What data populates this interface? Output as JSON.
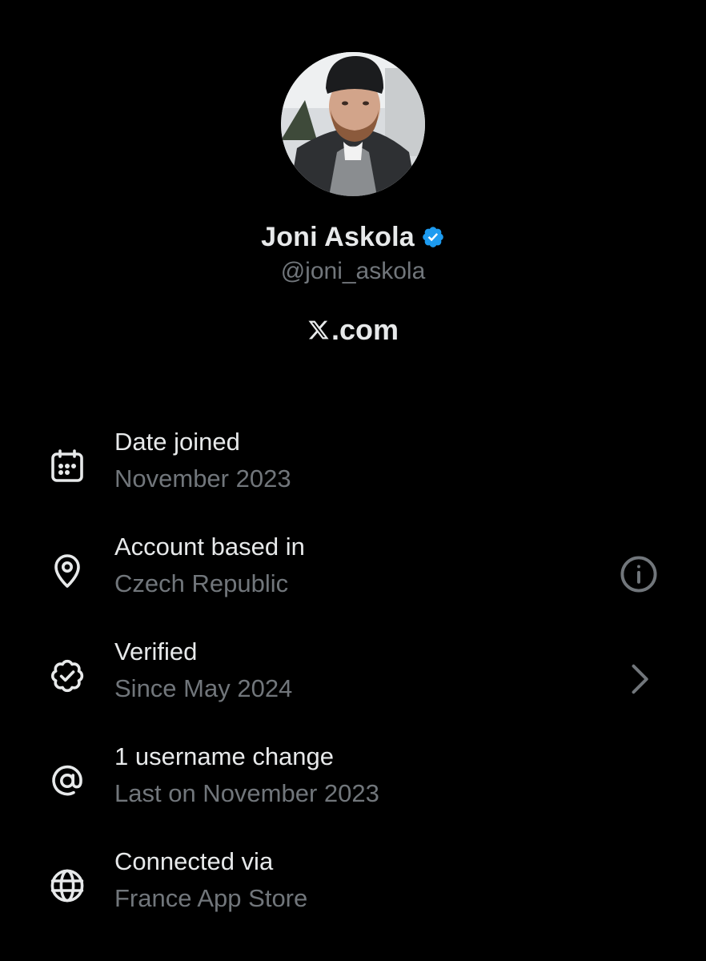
{
  "profile": {
    "display_name": "Joni Askola",
    "handle": "@joni_askola",
    "site": ".com",
    "site_logo_icon": "x-logo-icon",
    "badge_icon": "verified-badge-icon",
    "badge_color": "#1d9bf0"
  },
  "info": [
    {
      "icon": "calendar-icon",
      "title": "Date joined",
      "subtitle": "November 2023"
    },
    {
      "icon": "location-pin-icon",
      "title": "Account based in",
      "subtitle": "Czech Republic",
      "trailing_icon": "info-icon"
    },
    {
      "icon": "verified-check-icon",
      "title": "Verified",
      "subtitle": "Since May 2024",
      "trailing_icon": "chevron-right-icon"
    },
    {
      "icon": "at-sign-icon",
      "title": "1 username change",
      "subtitle": "Last on November 2023"
    },
    {
      "icon": "globe-icon",
      "title": "Connected via",
      "subtitle": "France App Store"
    }
  ],
  "colors": {
    "background": "#000000",
    "primary_text": "#e7e9ea",
    "secondary_text": "#71767b"
  }
}
